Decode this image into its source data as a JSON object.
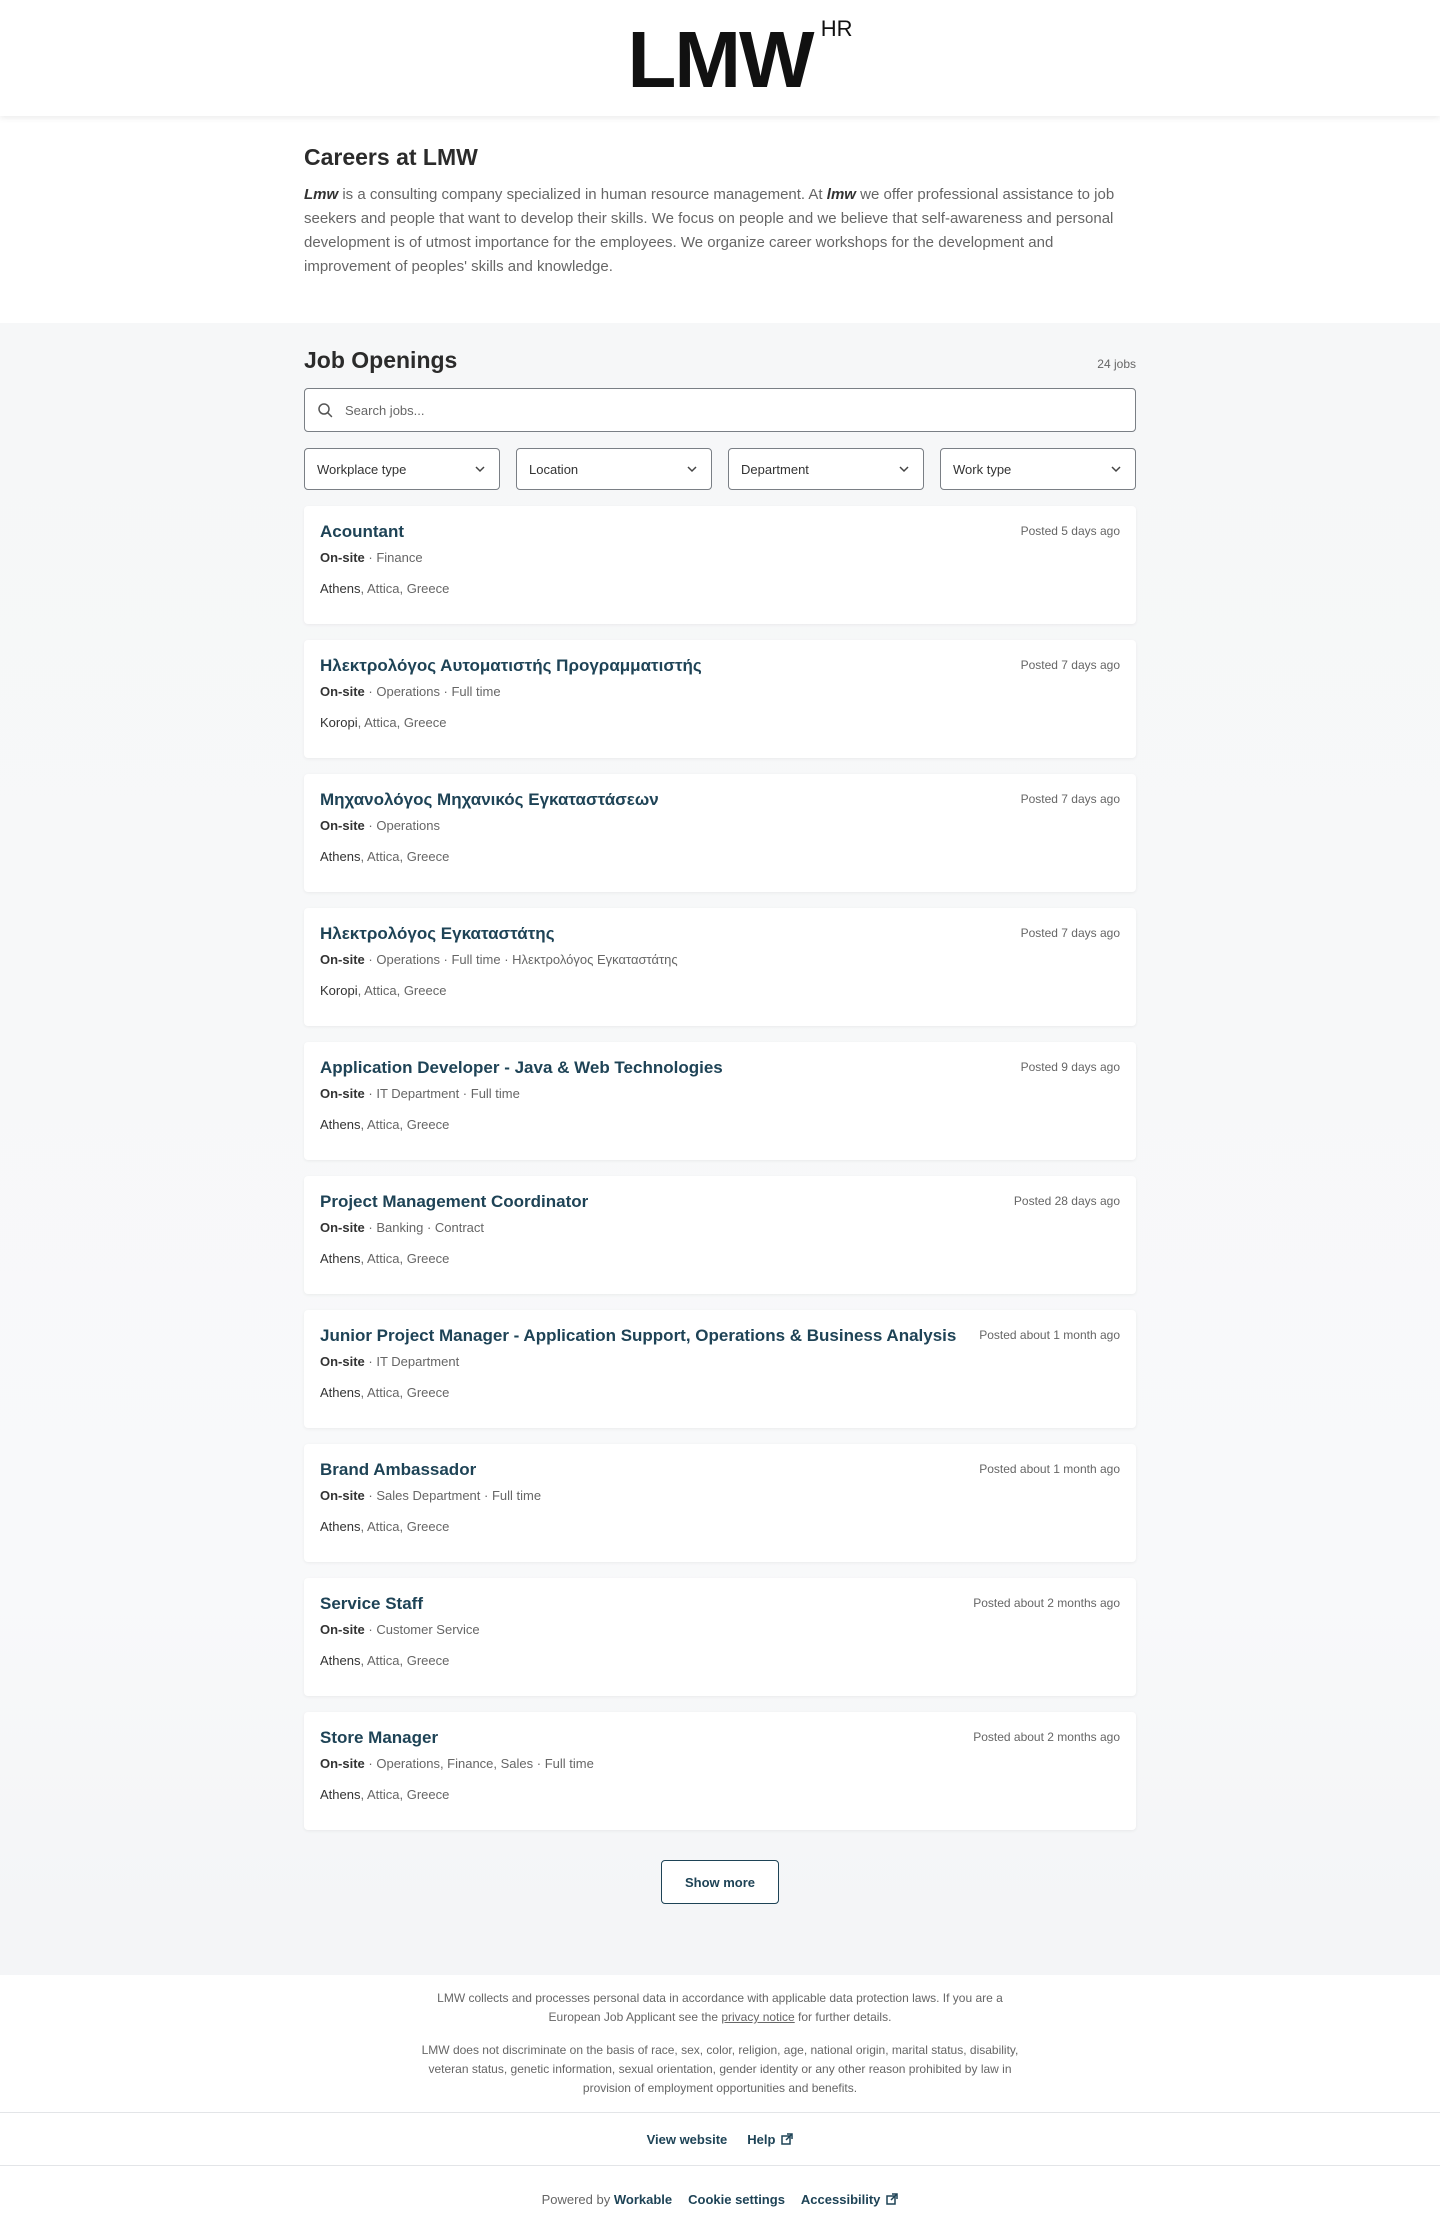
{
  "header": {
    "logo": "LMW",
    "logo_sup": "HR"
  },
  "intro": {
    "title": "Careers at LMW",
    "brand_em": "Lmw",
    "text_1": " is a consulting company specialized in human resource management. At ",
    "brand_em_2": "lmw",
    "text_2": " we offer professional assistance to job seekers and people that want to develop their skills. We focus on people and we believe that self-awareness and personal development is of utmost importance for the employees. We organize career workshops for the development and improvement of peoples' skills and knowledge."
  },
  "openings": {
    "title": "Job Openings",
    "count": "24 jobs",
    "search_placeholder": "Search jobs...",
    "filters": [
      "Workplace type",
      "Location",
      "Department",
      "Work type"
    ],
    "jobs": [
      {
        "title": "Acountant",
        "posted": "Posted 5 days ago",
        "workplace": "On-site",
        "meta": " · Finance",
        "city": "Athens",
        "region": ", Attica, Greece"
      },
      {
        "title": "Ηλεκτρολόγος Αυτοματιστής Προγραμματιστής",
        "posted": "Posted 7 days ago",
        "workplace": "On-site",
        "meta": " · Operations · Full time",
        "city": "Koropi",
        "region": ", Attica, Greece"
      },
      {
        "title": "Μηχανολόγος Μηχανικός Εγκαταστάσεων",
        "posted": "Posted 7 days ago",
        "workplace": "On-site",
        "meta": " · Operations",
        "city": "Athens",
        "region": ", Attica, Greece"
      },
      {
        "title": "Ηλεκτρολόγος Εγκαταστάτης",
        "posted": "Posted 7 days ago",
        "workplace": "On-site",
        "meta": " · Operations · Full time · Ηλεκτρολόγος Εγκαταστάτης",
        "city": "Koropi",
        "region": ", Attica, Greece"
      },
      {
        "title": "Application Developer - Java & Web Technologies",
        "posted": "Posted 9 days ago",
        "workplace": "On-site",
        "meta": " · IT Department · Full time",
        "city": "Athens",
        "region": ", Attica, Greece"
      },
      {
        "title": "Project Management Coordinator",
        "posted": "Posted 28 days ago",
        "workplace": "On-site",
        "meta": " · Banking · Contract",
        "city": "Athens",
        "region": ", Attica, Greece"
      },
      {
        "title": "Junior Project Manager - Application Support, Operations & Business Analysis",
        "posted": "Posted about 1 month ago",
        "workplace": "On-site",
        "meta": " · IT Department",
        "city": "Athens",
        "region": ", Attica, Greece"
      },
      {
        "title": "Brand Ambassador",
        "posted": "Posted about 1 month ago",
        "workplace": "On-site",
        "meta": " · Sales Department · Full time",
        "city": "Athens",
        "region": ", Attica, Greece"
      },
      {
        "title": "Service Staff",
        "posted": "Posted about 2 months ago",
        "workplace": "On-site",
        "meta": " · Customer Service",
        "city": "Athens",
        "region": ", Attica, Greece"
      },
      {
        "title": "Store Manager",
        "posted": "Posted about 2 months ago",
        "workplace": "On-site",
        "meta": " · Operations, Finance, Sales · Full time",
        "city": "Athens",
        "region": ", Attica, Greece"
      }
    ],
    "show_more": "Show more"
  },
  "legal": {
    "p1_a": "LMW collects and processes personal data in accordance with applicable data protection laws. If you are a European Job Applicant see the ",
    "p1_link": "privacy notice",
    "p1_b": " for further details.",
    "p2": "LMW does not discriminate on the basis of race, sex, color, religion, age, national origin, marital status, disability, veteran status, genetic information, sexual orientation, gender identity or any other reason prohibited by law in provision of employment opportunities and benefits."
  },
  "footer": {
    "view_website": "View website",
    "help": "Help",
    "powered_by": "Powered by ",
    "workable": "Workable",
    "cookie_settings": "Cookie settings",
    "accessibility": "Accessibility"
  },
  "colors": {
    "accent": "#1e4356",
    "text": "#333333",
    "muted": "#666666",
    "band": "#f6f7f8"
  },
  "icons": {
    "search": "search-icon",
    "chevron": "chevron-down-icon",
    "external": "external-link-icon"
  }
}
